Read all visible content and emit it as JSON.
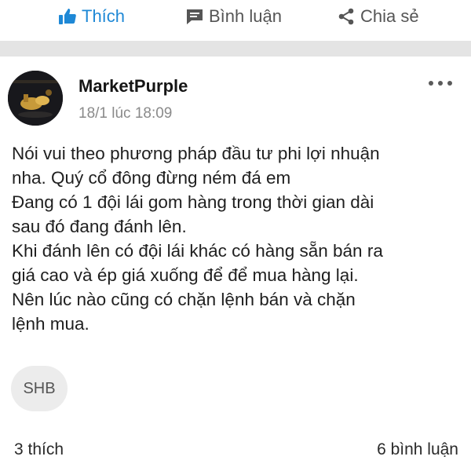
{
  "action_bar": {
    "like_label": "Thích",
    "comment_label": "Bình luận",
    "share_label": "Chia sẻ",
    "like_color": "#1e88d6",
    "icon_names": [
      "thumbs-up-icon",
      "comment-icon",
      "share-icon"
    ]
  },
  "post": {
    "author": "MarketPurple",
    "timestamp": "18/1 lúc 18:09",
    "more_icon": "more-horizontal-icon",
    "lines": [
      "Nói vui theo phương pháp đầu tư phi lợi nhuận",
      "nha. Quý cổ đông đừng ném đá em",
      "Đang có 1 đội lái gom hàng trong thời gian dài",
      "sau đó đang đánh lên.",
      "Khi đánh lên có đội lái khác có hàng sẵn bán ra",
      "giá cao và ép giá xuống để để mua hàng lại.",
      "Nên lúc nào cũng có chặn lệnh bán và chặn",
      "lệnh mua."
    ],
    "tag": "SHB",
    "likes": "3 thích",
    "comments": "6 bình luận"
  }
}
